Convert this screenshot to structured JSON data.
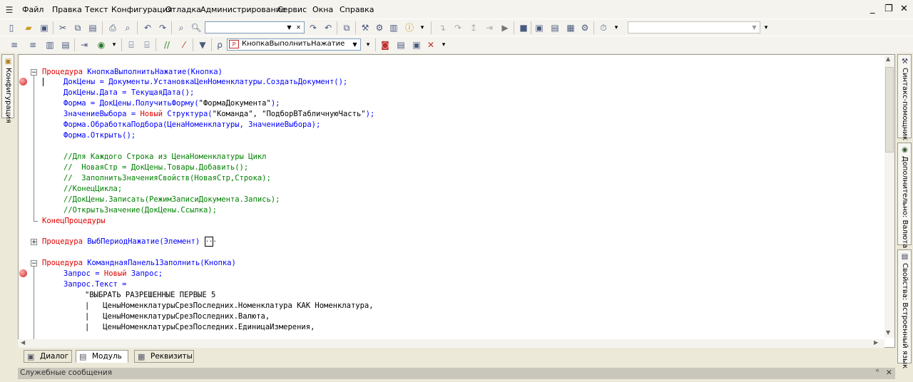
{
  "menu": {
    "items": [
      "Файл",
      "Правка",
      "Текст",
      "Конфигурация",
      "Отладка",
      "Администрирование",
      "Сервис",
      "Окна",
      "Справка"
    ]
  },
  "toolbar2": {
    "procedure_combo": "КнопкаВыполнитьНажатие"
  },
  "left_panel": {
    "configuration_tab": "Конфигурация"
  },
  "right_panel": {
    "syntax_helper_tab": "Синтакс-помощник",
    "extra_currency_tab": "Дополнительно: Валюта",
    "properties_tab": "Свойства: Встроенный язык"
  },
  "bottom_tabs": [
    {
      "label": "Диалог",
      "icon": "dialog-icon"
    },
    {
      "label": "Модуль",
      "icon": "module-icon"
    },
    {
      "label": "Реквизиты",
      "icon": "attributes-icon"
    }
  ],
  "service_messages": {
    "title": "Служебные сообщения",
    "pin_glyph": "ᵒ",
    "close_glyph": "✕"
  },
  "code": {
    "l1_kw": "Процедура ",
    "l1_id": "КнопкаВыполнитьНажатие(Кнопка)",
    "l2": "ДокЦены = Документы.УстановкаЦенНоменклатуры.СоздатьДокумент();",
    "l3": "ДокЦены.Дата = ТекущаяДата();",
    "l4a": "Форма = ДокЦены.ПолучитьФорму(",
    "l4s": "\"ФормаДокумента\"",
    "l4b": ");",
    "l5a": "ЗначениеВыбора = ",
    "l5k": "Новый",
    "l5b": " Структура(",
    "l5s": "\"Команда\", \"ПодборВТабличнуюЧасть\"",
    "l5c": ");",
    "l6": "Форма.ОбработкаПодбора(ЦенаНоменклатуры, ЗначениеВыбора);",
    "l7": "Форма.Открыть();",
    "c1": "//Для Каждого Строка из ЦенаНоменклатуры Цикл",
    "c2": "//  НоваяСтр = ДокЦены.Товары.Добавить();",
    "c3": "//  ЗаполнитьЗначенияСвойств(НоваяСтр,Строка);",
    "c4": "//КонецЦикла;",
    "c5": "//ДокЦены.Записать(РежимЗаписиДокумента.Запись);",
    "c6": "//ОткрытьЗначение(ДокЦены.Ссылка);",
    "end_proc": "КонецПроцедуры",
    "p2_kw": "Процедура ",
    "p2_id": "ВыбПериодНажатие(Элемент)",
    "p2_ellipsis": "...",
    "p3_kw": "Процедура ",
    "p3_id": "КоманднаяПанель1Заполнить(Кнопка)",
    "q1a": "Запрос = ",
    "q1k": "Новый",
    "q1b": " Запрос;",
    "q2": "Запрос.Текст =",
    "q3": "\"ВЫБРАТЬ РАЗРЕШЕННЫЕ ПЕРВЫЕ 5",
    "q4": "|   ЦеныНоменклатурыСрезПоследних.Номенклатура КАК Номенклатура,",
    "q5": "|   ЦеныНоменклатурыСрезПоследних.Валюта,",
    "q6": "|   ЦеныНоменклатурыСрезПоследних.ЕдиницаИзмерения,"
  }
}
